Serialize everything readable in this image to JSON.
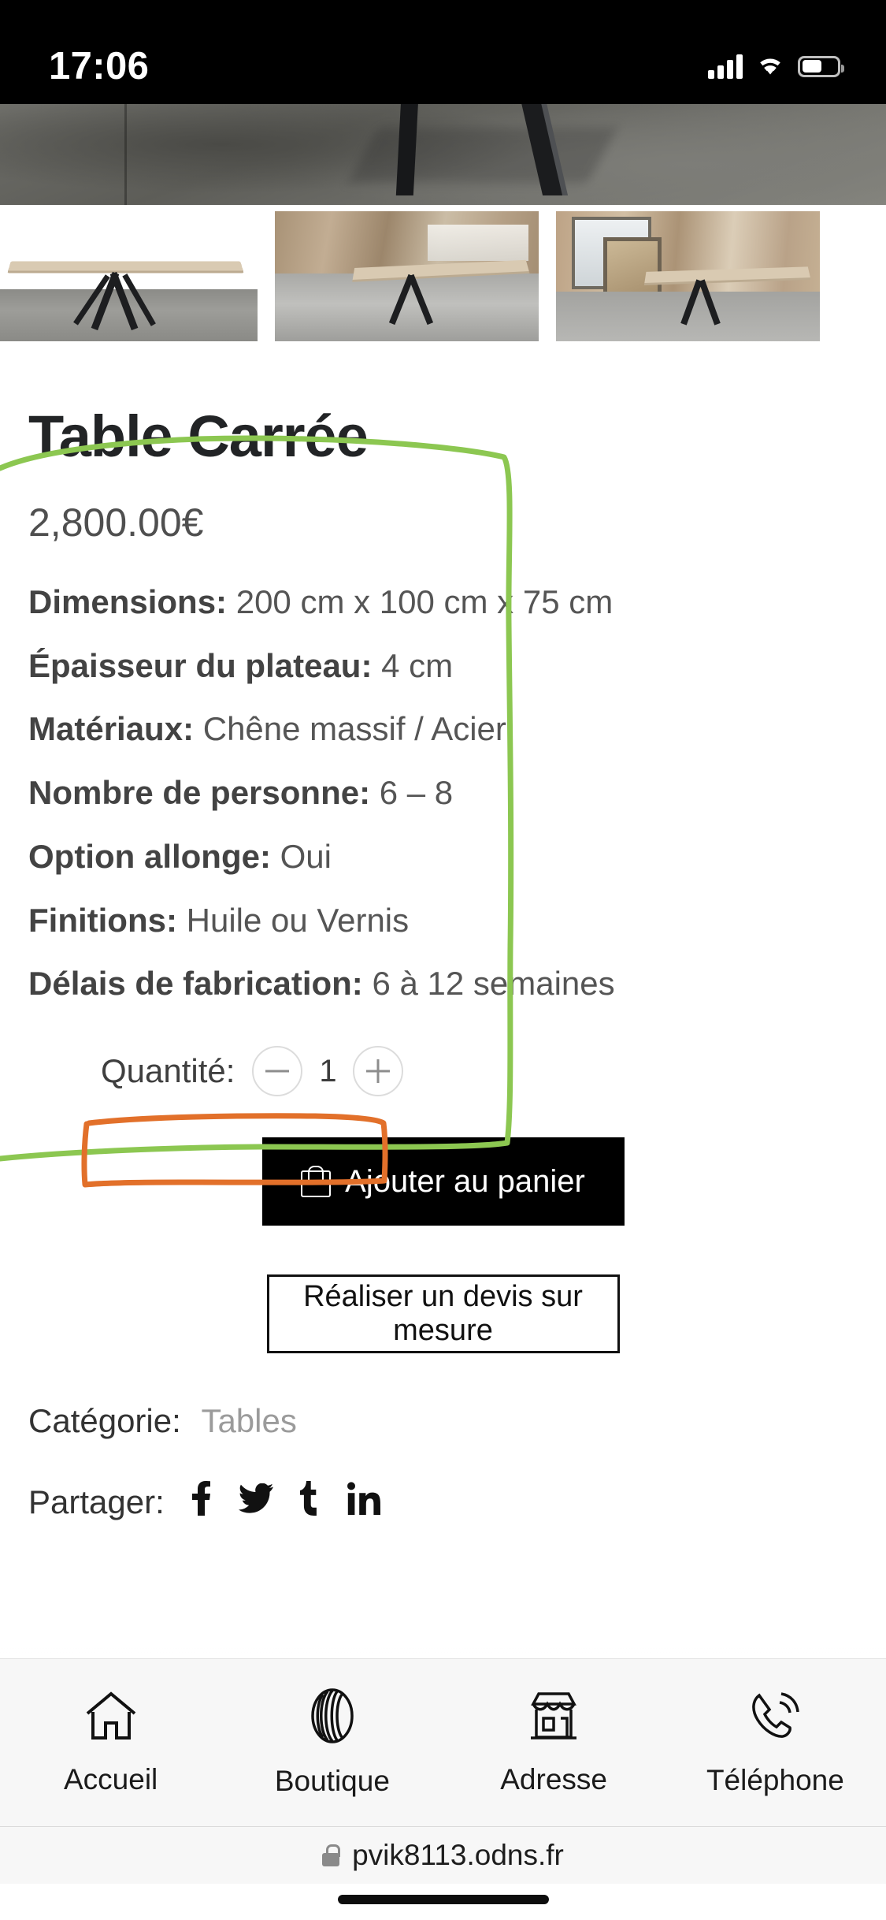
{
  "status_bar": {
    "time": "17:06",
    "signal_icon": "cellular-bars-icon",
    "wifi_icon": "wifi-icon",
    "battery_icon": "battery-icon"
  },
  "gallery": {
    "main_image_alt": "table-carree-main-photo",
    "thumbnails": [
      {
        "alt": "table-carree-thumbnail-1"
      },
      {
        "alt": "table-carree-thumbnail-2"
      },
      {
        "alt": "table-carree-thumbnail-3"
      }
    ]
  },
  "product": {
    "title": "Table Carrée",
    "price": "2,800.00€",
    "specs": [
      {
        "label": "Dimensions:",
        "value": "200 cm x 100 cm x 75 cm"
      },
      {
        "label": "Épaisseur du plateau:",
        "value": "4 cm"
      },
      {
        "label": "Matériaux:",
        "value": "Chêne massif / Acier"
      },
      {
        "label": "Nombre de personne:",
        "value": "6 – 8"
      },
      {
        "label": "Option allonge:",
        "value": "Oui"
      },
      {
        "label": "Finitions:",
        "value": "Huile ou Vernis"
      },
      {
        "label": "Délais de fabrication:",
        "value": "6 à 12 semaines"
      }
    ],
    "quantity": {
      "label": "Quantité:",
      "value": "1",
      "decrease_icon": "minus-icon",
      "increase_icon": "plus-icon"
    },
    "add_to_cart_label": "Ajouter au panier",
    "add_to_cart_icon": "shopping-bag-icon",
    "quote_button_label": "Réaliser un devis sur mesure",
    "category_label": "Catégorie:",
    "category_value": "Tables",
    "share_label": "Partager:",
    "share_icons": [
      "facebook-icon",
      "twitter-icon",
      "tumblr-icon",
      "linkedin-icon"
    ]
  },
  "annotations": {
    "green_highlight_color": "#8cc751",
    "orange_highlight_color": "#e2702a"
  },
  "bottom_nav": [
    {
      "label": "Accueil",
      "icon": "home-icon"
    },
    {
      "label": "Boutique",
      "icon": "wood-log-icon"
    },
    {
      "label": "Adresse",
      "icon": "storefront-icon"
    },
    {
      "label": "Téléphone",
      "icon": "phone-icon"
    }
  ],
  "browser": {
    "url": "pvik8113.odns.fr",
    "lock_icon": "lock-icon"
  }
}
